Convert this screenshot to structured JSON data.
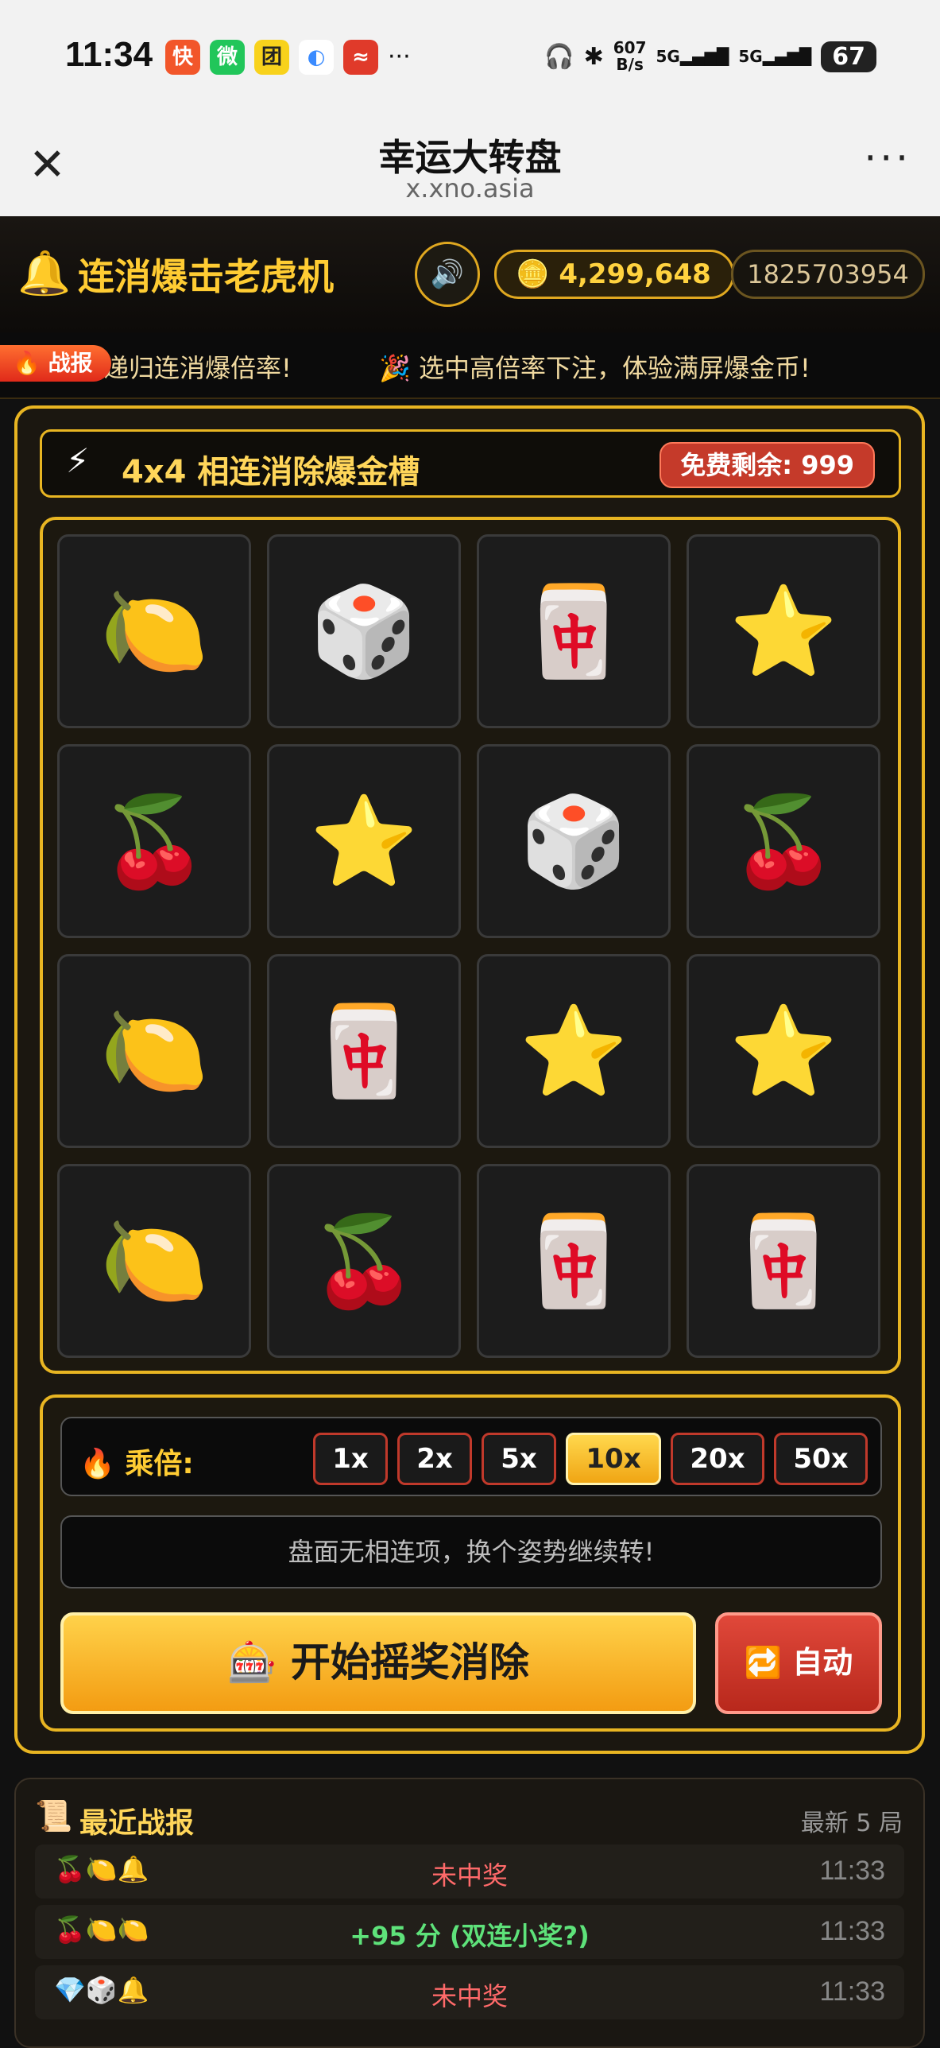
{
  "status_bar": {
    "time": "11:34",
    "apps": [
      "快",
      "微",
      "团",
      "◐",
      "≈"
    ],
    "app_colors": [
      "#f2562a",
      "#21c65a",
      "#f8d21c",
      "#3a8bff",
      "#e03a2a"
    ],
    "more": "···",
    "speed": "607\nB/s",
    "signal_1": "5G",
    "signal_2": "5G",
    "battery": "67"
  },
  "browser": {
    "title": "幸运大转盘",
    "url": "x.xno.asia",
    "close_glyph": "✕",
    "more_glyph": "···"
  },
  "header": {
    "logo": "🔔",
    "app_name": "连消爆击老虎机",
    "sound_icon": "🔊",
    "coin_icon": "🪙",
    "coins": "4,299,648",
    "user_id": "1825703954"
  },
  "ticker": {
    "badge": "🔥 战报",
    "messages": [
      "递归连消爆倍率!",
      "🎉 选中高倍率下注，体验满屏爆金币!"
    ]
  },
  "panel": {
    "bolt": "⚡",
    "title": "4x4 相连消除爆金槽",
    "free_label": "免费剩余: 999"
  },
  "grid": [
    [
      "🍋",
      "🎲",
      "🀄",
      "⭐"
    ],
    [
      "🍒",
      "⭐",
      "🎲",
      "🍒"
    ],
    [
      "🍋",
      "🀄",
      "⭐",
      "⭐"
    ],
    [
      "🍋",
      "🍒",
      "🀄",
      "🀄"
    ]
  ],
  "controls": {
    "multiplier_label": "🔥 乘倍:",
    "multipliers": [
      "1x",
      "2x",
      "5x",
      "10x",
      "20x",
      "50x"
    ],
    "selected_multiplier": "10x",
    "message": "盘面无相连项，换个姿势继续转!",
    "start_label": "🎰 开始摇奖消除",
    "auto_label": "🔁 自动"
  },
  "history": {
    "icon": "📜",
    "title": "最近战报",
    "latest": "最新 5 局",
    "rows": [
      {
        "icons": "🍒🍋🔔",
        "result": "未中奖",
        "time": "11:33"
      },
      {
        "icons": "🍒🍋🍋",
        "result": "+95 分 (双连小奖?)",
        "time": "11:33"
      },
      {
        "icons": "💎🎲🔔",
        "result": "未中奖",
        "time": "11:33"
      }
    ]
  }
}
